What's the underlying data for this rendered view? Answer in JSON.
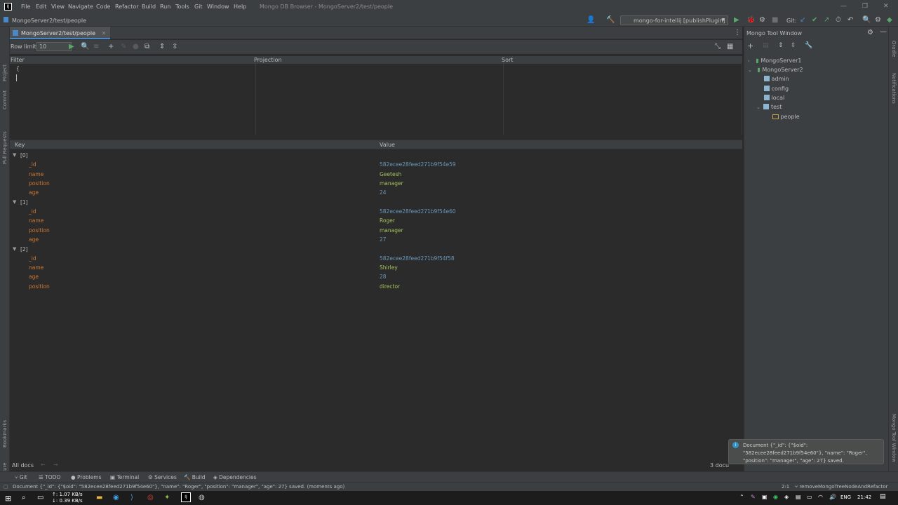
{
  "titlebar": {
    "menus": [
      "File",
      "Edit",
      "View",
      "Navigate",
      "Code",
      "Refactor",
      "Build",
      "Run",
      "Tools",
      "Git",
      "Window",
      "Help"
    ],
    "title": "Mongo DB Browser - MongoServer2/test/people"
  },
  "navbar": {
    "breadcrumb": "MongoServer2/test/people",
    "run_config": "mongo-for-intellij [publishPlugin]",
    "git_label": "Git:"
  },
  "editor_tab": {
    "label": "MongoServer2/test/people"
  },
  "toolbar": {
    "row_limit_label": "Row limit:",
    "row_limit_value": "10"
  },
  "query": {
    "filter_label": "Filter",
    "projection_label": "Projection",
    "sort_label": "Sort",
    "filter_text": "{"
  },
  "grid": {
    "key_header": "Key",
    "value_header": "Value",
    "documents": [
      {
        "index": "[0]",
        "fields": [
          {
            "key": "_id",
            "value": "582ecee28feed271b9f54e59",
            "type": "oid"
          },
          {
            "key": "name",
            "value": "Geetesh",
            "type": "str"
          },
          {
            "key": "position",
            "value": "manager",
            "type": "str"
          },
          {
            "key": "age",
            "value": "24",
            "type": "num"
          }
        ]
      },
      {
        "index": "[1]",
        "fields": [
          {
            "key": "_id",
            "value": "582ecee28feed271b9f54e60",
            "type": "oid"
          },
          {
            "key": "name",
            "value": "Roger",
            "type": "str"
          },
          {
            "key": "position",
            "value": "manager",
            "type": "str"
          },
          {
            "key": "age",
            "value": "27",
            "type": "num"
          }
        ]
      },
      {
        "index": "[2]",
        "fields": [
          {
            "key": "_id",
            "value": "582ecee28feed271b9f54f58",
            "type": "oid"
          },
          {
            "key": "name",
            "value": "Shirley",
            "type": "str"
          },
          {
            "key": "age",
            "value": "28",
            "type": "num"
          },
          {
            "key": "position",
            "value": "director",
            "type": "str"
          }
        ]
      }
    ]
  },
  "bottom": {
    "all_docs": "All docs",
    "doc_count": "3 docu"
  },
  "left_strip": [
    "Project",
    "Commit",
    "Pull Requests",
    "Bookmarks",
    "Structure"
  ],
  "right_strip": [
    "Gradle",
    "Notifications",
    "Mongo Tool Window"
  ],
  "tool_windows": [
    "Git",
    "TODO",
    "Problems",
    "Terminal",
    "Services",
    "Build",
    "Dependencies"
  ],
  "mongo_panel": {
    "title": "Mongo Tool Window",
    "servers": [
      "MongoServer1",
      "MongoServer2"
    ],
    "databases": [
      "admin",
      "config",
      "local",
      "test"
    ],
    "collections": [
      "people"
    ]
  },
  "notification": {
    "text": "Document {\"_id\": {\"$oid\": \"582ecee28feed271b9f54e60\"}, \"name\": \"Roger\", \"position\": \"manager\", \"age\": 27} saved."
  },
  "statusbar": {
    "message": "Document {\"_id\": {\"$oid\": \"582ecee28feed271b9f54e60\"}, \"name\": \"Roger\", \"position\": \"manager\", \"age\": 27} saved. (moments ago)",
    "position": "2:1",
    "branch": "removeMongoTreeNodeAndRefactor"
  },
  "taskbar": {
    "net_up": "↑: 1.07 KB/s",
    "net_down": "↓: 0.39 KB/s",
    "lang": "ENG",
    "time": "21:42"
  },
  "colors": {
    "accent": "#4a88c7",
    "key_color": "#cc7832",
    "string_color": "#a5c25c",
    "number_color": "#6897bb",
    "run_green": "#59a869"
  }
}
